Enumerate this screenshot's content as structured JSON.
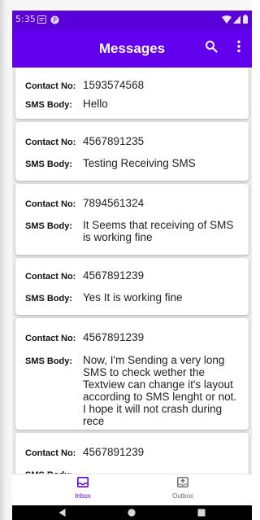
{
  "status_bar": {
    "time": "5:35"
  },
  "app_bar": {
    "title": "Messages",
    "search_icon": "search-icon",
    "menu_icon": "more-vert-icon"
  },
  "labels": {
    "contact": "Contact No:",
    "body": "SMS Body:"
  },
  "messages": [
    {
      "contact": "1593574568",
      "body": "Hello"
    },
    {
      "contact": "4567891235",
      "body": "Testing Receiving SMS"
    },
    {
      "contact": "7894561324",
      "body": "It Seems that receiving of SMS is working fine"
    },
    {
      "contact": "4567891239",
      "body": "Yes It is working fine"
    },
    {
      "contact": "4567891239",
      "body": "Now, I'm Sending a very long SMS to check wether the Textview can change it's layout according to SMS lenght or not.\nI hope it will not crash during rece"
    },
    {
      "contact": "4567891239",
      "body": ""
    }
  ],
  "bottom_nav": {
    "items": [
      {
        "label": "Inbox",
        "icon": "inbox-icon",
        "selected": true
      },
      {
        "label": "Outbox",
        "icon": "outbox-icon",
        "selected": false
      }
    ],
    "active_color": "#6200ee",
    "inactive_color": "#666666"
  },
  "colors": {
    "status_bar": "#5a00d8",
    "app_bar": "#6200ee"
  }
}
